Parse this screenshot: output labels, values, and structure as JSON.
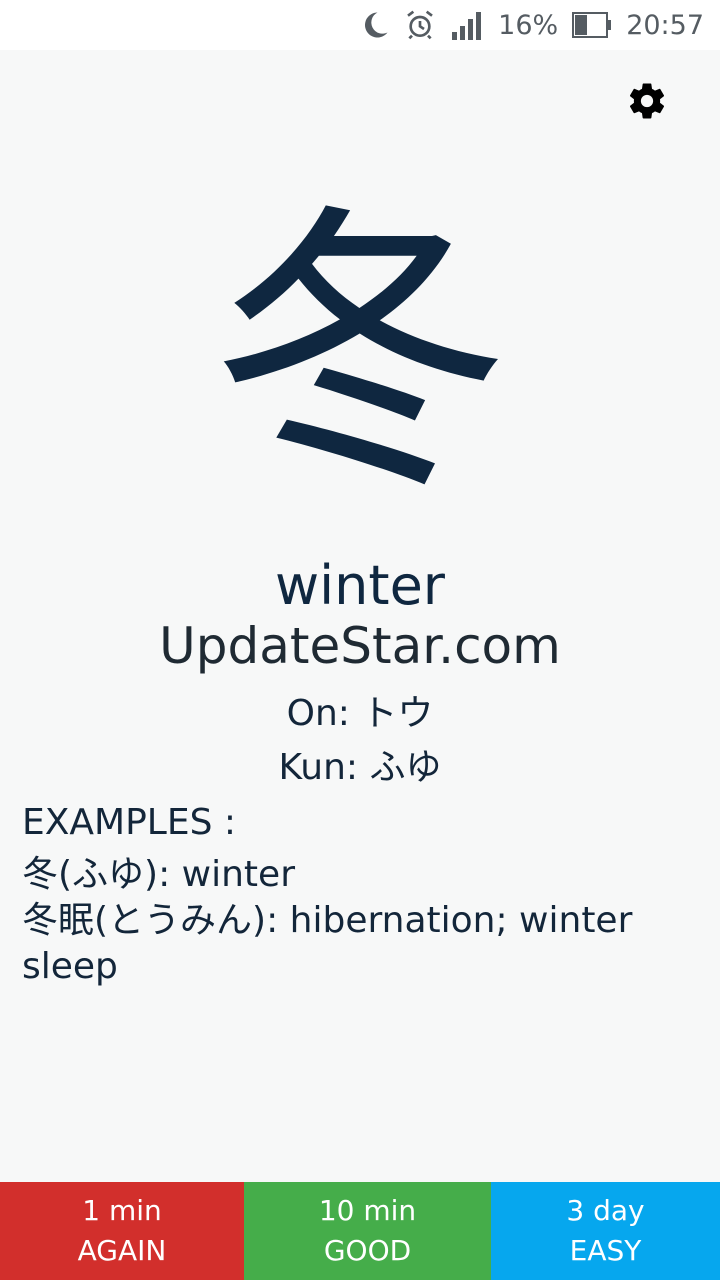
{
  "status_bar": {
    "battery_percent": "16%",
    "time": "20:57",
    "icons": [
      "moon-icon",
      "alarm-icon",
      "signal-icon",
      "battery-icon"
    ]
  },
  "card": {
    "kanji": "冬",
    "meaning": "winter",
    "watermark": "UpdateStar.com",
    "on_reading": "On: トウ",
    "kun_reading": "Kun: ふゆ",
    "examples_title": "EXAMPLES :",
    "examples": [
      "冬(ふゆ): winter",
      "冬眠(とうみん): hibernation; winter sleep"
    ]
  },
  "settings": {
    "icon": "gear-icon"
  },
  "rating_buttons": {
    "again": {
      "interval": "1 min",
      "label": "AGAIN",
      "color": "#d22f2c"
    },
    "good": {
      "interval": "10 min",
      "label": "GOOD",
      "color": "#45ad4a"
    },
    "easy": {
      "interval": "3 day",
      "label": "EASY",
      "color": "#06a7ee"
    }
  }
}
